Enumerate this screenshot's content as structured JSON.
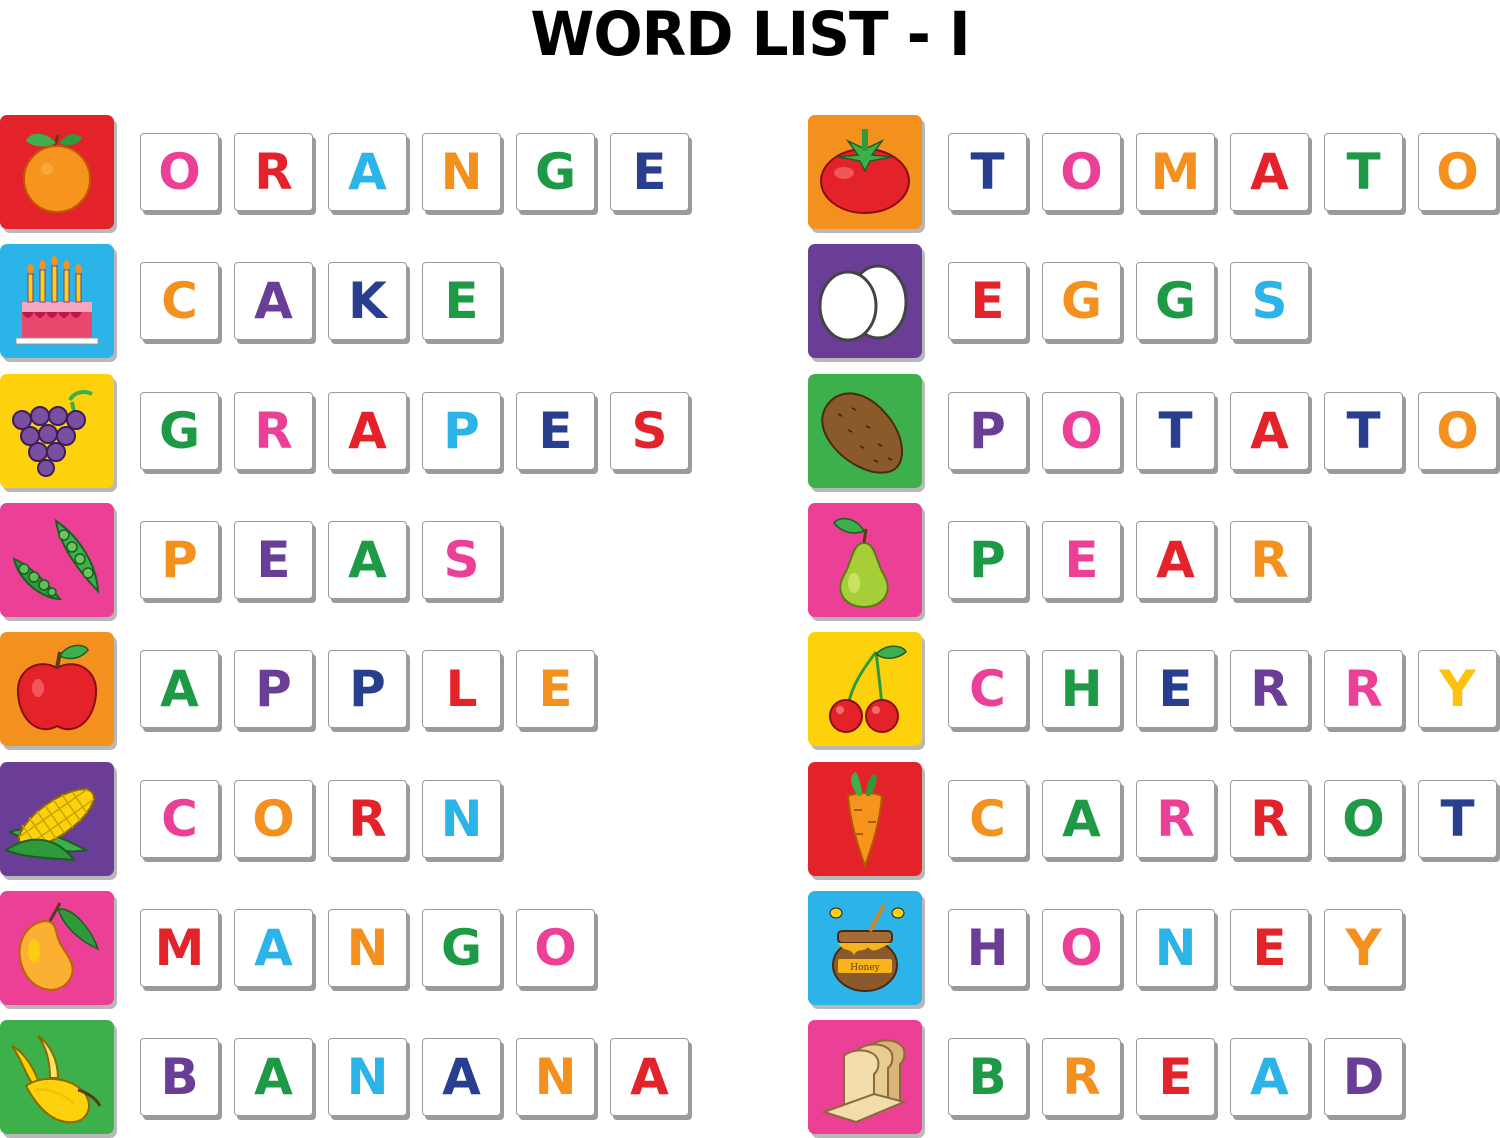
{
  "title": "WORD LIST - I",
  "colors": {
    "orange_bg": "#e4222a",
    "tomato_bg": "#f4901e",
    "cake_bg": "#2cb4e8",
    "eggs_bg": "#6a3d97",
    "grapes_bg": "#fdd20d",
    "potato_bg": "#3db04b",
    "peas_bg": "#ec3f96",
    "pear_bg": "#ec3f96",
    "apple_bg": "#f4901e",
    "cherry_bg": "#fdd20d",
    "corn_bg": "#6a3d97",
    "carrot_bg": "#e4222a",
    "mango_bg": "#ec3f96",
    "honey_bg": "#2cb4e8",
    "banana_bg": "#3db04b",
    "bread_bg": "#ec3f96"
  },
  "words": [
    {
      "word": "ORANGE",
      "icon": "orange-icon",
      "icon_bg": "#e4222a",
      "letters": [
        {
          "ch": "O",
          "color": "#ec3f96"
        },
        {
          "ch": "R",
          "color": "#e4222a"
        },
        {
          "ch": "A",
          "color": "#2cb4e8"
        },
        {
          "ch": "N",
          "color": "#f4901e"
        },
        {
          "ch": "G",
          "color": "#1e9a46"
        },
        {
          "ch": "E",
          "color": "#283f8f"
        }
      ]
    },
    {
      "word": "CAKE",
      "icon": "cake-icon",
      "icon_bg": "#2cb4e8",
      "letters": [
        {
          "ch": "C",
          "color": "#f4901e"
        },
        {
          "ch": "A",
          "color": "#6a3d97"
        },
        {
          "ch": "K",
          "color": "#283f8f"
        },
        {
          "ch": "E",
          "color": "#1e9a46"
        }
      ]
    },
    {
      "word": "GRAPES",
      "icon": "grapes-icon",
      "icon_bg": "#fdd20d",
      "letters": [
        {
          "ch": "G",
          "color": "#1e9a46"
        },
        {
          "ch": "R",
          "color": "#ec3f96"
        },
        {
          "ch": "A",
          "color": "#e4222a"
        },
        {
          "ch": "P",
          "color": "#2cb4e8"
        },
        {
          "ch": "E",
          "color": "#283f8f"
        },
        {
          "ch": "S",
          "color": "#e4222a"
        }
      ]
    },
    {
      "word": "PEAS",
      "icon": "peas-icon",
      "icon_bg": "#ec3f96",
      "letters": [
        {
          "ch": "P",
          "color": "#f4901e"
        },
        {
          "ch": "E",
          "color": "#6a3d97"
        },
        {
          "ch": "A",
          "color": "#1e9a46"
        },
        {
          "ch": "S",
          "color": "#ec3f96"
        }
      ]
    },
    {
      "word": "APPLE",
      "icon": "apple-icon",
      "icon_bg": "#f4901e",
      "letters": [
        {
          "ch": "A",
          "color": "#1e9a46"
        },
        {
          "ch": "P",
          "color": "#6a3d97"
        },
        {
          "ch": "P",
          "color": "#283f8f"
        },
        {
          "ch": "L",
          "color": "#e4222a"
        },
        {
          "ch": "E",
          "color": "#f4901e"
        }
      ]
    },
    {
      "word": "CORN",
      "icon": "corn-icon",
      "icon_bg": "#6a3d97",
      "letters": [
        {
          "ch": "C",
          "color": "#ec3f96"
        },
        {
          "ch": "O",
          "color": "#f4901e"
        },
        {
          "ch": "R",
          "color": "#e4222a"
        },
        {
          "ch": "N",
          "color": "#2cb4e8"
        }
      ]
    },
    {
      "word": "MANGO",
      "icon": "mango-icon",
      "icon_bg": "#ec3f96",
      "letters": [
        {
          "ch": "M",
          "color": "#e4222a"
        },
        {
          "ch": "A",
          "color": "#2cb4e8"
        },
        {
          "ch": "N",
          "color": "#f4901e"
        },
        {
          "ch": "G",
          "color": "#1e9a46"
        },
        {
          "ch": "O",
          "color": "#ec3f96"
        }
      ]
    },
    {
      "word": "BANANA",
      "icon": "banana-icon",
      "icon_bg": "#3db04b",
      "letters": [
        {
          "ch": "B",
          "color": "#6a3d97"
        },
        {
          "ch": "A",
          "color": "#1e9a46"
        },
        {
          "ch": "N",
          "color": "#2cb4e8"
        },
        {
          "ch": "A",
          "color": "#283f8f"
        },
        {
          "ch": "N",
          "color": "#f4901e"
        },
        {
          "ch": "A",
          "color": "#e4222a"
        }
      ]
    },
    {
      "word": "TOMATO",
      "icon": "tomato-icon",
      "icon_bg": "#f4901e",
      "letters": [
        {
          "ch": "T",
          "color": "#283f8f"
        },
        {
          "ch": "O",
          "color": "#ec3f96"
        },
        {
          "ch": "M",
          "color": "#f4901e"
        },
        {
          "ch": "A",
          "color": "#e4222a"
        },
        {
          "ch": "T",
          "color": "#1e9a46"
        },
        {
          "ch": "O",
          "color": "#f4901e"
        }
      ]
    },
    {
      "word": "EGGS",
      "icon": "eggs-icon",
      "icon_bg": "#6a3d97",
      "letters": [
        {
          "ch": "E",
          "color": "#e4222a"
        },
        {
          "ch": "G",
          "color": "#f4901e"
        },
        {
          "ch": "G",
          "color": "#1e9a46"
        },
        {
          "ch": "S",
          "color": "#2cb4e8"
        }
      ]
    },
    {
      "word": "POTATO",
      "icon": "potato-icon",
      "icon_bg": "#3db04b",
      "letters": [
        {
          "ch": "P",
          "color": "#6a3d97"
        },
        {
          "ch": "O",
          "color": "#ec3f96"
        },
        {
          "ch": "T",
          "color": "#283f8f"
        },
        {
          "ch": "A",
          "color": "#e4222a"
        },
        {
          "ch": "T",
          "color": "#283f8f"
        },
        {
          "ch": "O",
          "color": "#f4901e"
        }
      ]
    },
    {
      "word": "PEAR",
      "icon": "pear-icon",
      "icon_bg": "#ec3f96",
      "letters": [
        {
          "ch": "P",
          "color": "#1e9a46"
        },
        {
          "ch": "E",
          "color": "#ec3f96"
        },
        {
          "ch": "A",
          "color": "#e4222a"
        },
        {
          "ch": "R",
          "color": "#f4901e"
        }
      ]
    },
    {
      "word": "CHERRY",
      "icon": "cherry-icon",
      "icon_bg": "#fdd20d",
      "letters": [
        {
          "ch": "C",
          "color": "#ec3f96"
        },
        {
          "ch": "H",
          "color": "#1e9a46"
        },
        {
          "ch": "E",
          "color": "#283f8f"
        },
        {
          "ch": "R",
          "color": "#6a3d97"
        },
        {
          "ch": "R",
          "color": "#ec3f96"
        },
        {
          "ch": "Y",
          "color": "#fdc20d"
        }
      ]
    },
    {
      "word": "CARROT",
      "icon": "carrot-icon",
      "icon_bg": "#e4222a",
      "letters": [
        {
          "ch": "C",
          "color": "#f4901e"
        },
        {
          "ch": "A",
          "color": "#1e9a46"
        },
        {
          "ch": "R",
          "color": "#ec3f96"
        },
        {
          "ch": "R",
          "color": "#e4222a"
        },
        {
          "ch": "O",
          "color": "#1e9a46"
        },
        {
          "ch": "T",
          "color": "#283f8f"
        }
      ]
    },
    {
      "word": "HONEY",
      "icon": "honey-icon",
      "icon_bg": "#2cb4e8",
      "letters": [
        {
          "ch": "H",
          "color": "#6a3d97"
        },
        {
          "ch": "O",
          "color": "#ec3f96"
        },
        {
          "ch": "N",
          "color": "#2cb4e8"
        },
        {
          "ch": "E",
          "color": "#e4222a"
        },
        {
          "ch": "Y",
          "color": "#f4901e"
        }
      ]
    },
    {
      "word": "BREAD",
      "icon": "bread-icon",
      "icon_bg": "#ec3f96",
      "letters": [
        {
          "ch": "B",
          "color": "#1e9a46"
        },
        {
          "ch": "R",
          "color": "#f4901e"
        },
        {
          "ch": "E",
          "color": "#e4222a"
        },
        {
          "ch": "A",
          "color": "#2cb4e8"
        },
        {
          "ch": "D",
          "color": "#6a3d97"
        }
      ]
    }
  ],
  "honey_label": "Honey"
}
